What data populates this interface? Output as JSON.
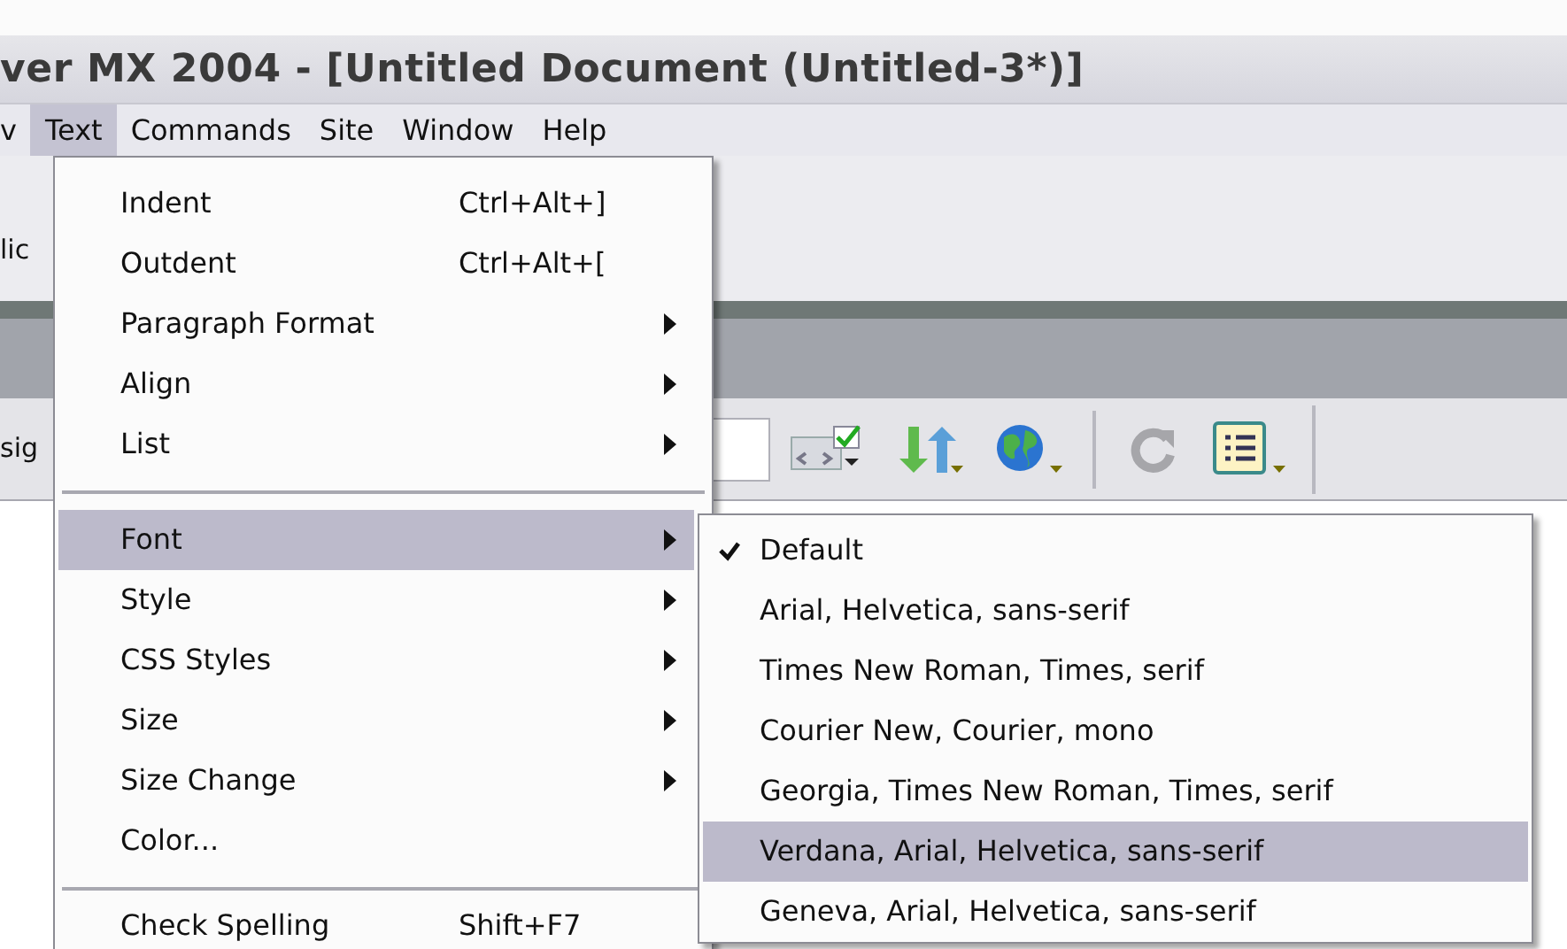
{
  "window": {
    "title": "ver MX 2004 - [Untitled Document (Untitled-3*)]"
  },
  "menu_bar": [
    {
      "label": "v",
      "selected": false
    },
    {
      "label": "Text",
      "selected": true
    },
    {
      "label": "Commands",
      "selected": false
    },
    {
      "label": "Site",
      "selected": false
    },
    {
      "label": "Window",
      "selected": false
    },
    {
      "label": "Help",
      "selected": false
    }
  ],
  "toolbar_1": {
    "label": "lic"
  },
  "toolbar_2": {
    "label": "sig"
  },
  "text_menu": [
    {
      "kind": "item",
      "label": "Indent",
      "shortcut": "Ctrl+Alt+]",
      "selected": false
    },
    {
      "kind": "item",
      "label": "Outdent",
      "shortcut": "Ctrl+Alt+[",
      "selected": false
    },
    {
      "kind": "submenu",
      "label": "Paragraph Format",
      "selected": false
    },
    {
      "kind": "submenu",
      "label": "Align",
      "selected": false
    },
    {
      "kind": "submenu",
      "label": "List",
      "selected": false
    },
    {
      "kind": "separator"
    },
    {
      "kind": "submenu",
      "label": "Font",
      "selected": true
    },
    {
      "kind": "submenu",
      "label": "Style",
      "selected": false
    },
    {
      "kind": "submenu",
      "label": "CSS Styles",
      "selected": false
    },
    {
      "kind": "submenu",
      "label": "Size",
      "selected": false
    },
    {
      "kind": "submenu",
      "label": "Size Change",
      "selected": false
    },
    {
      "kind": "item",
      "label": "Color...",
      "selected": false
    },
    {
      "kind": "separator"
    },
    {
      "kind": "item",
      "label": "Check Spelling",
      "shortcut": "Shift+F7",
      "selected": false
    }
  ],
  "font_submenu": [
    {
      "label": "Default",
      "checked": true,
      "selected": false
    },
    {
      "label": "Arial, Helvetica, sans-serif",
      "checked": false,
      "selected": false
    },
    {
      "label": "Times New Roman, Times, serif",
      "checked": false,
      "selected": false
    },
    {
      "label": "Courier New, Courier, mono",
      "checked": false,
      "selected": false
    },
    {
      "label": "Georgia, Times New Roman, Times, serif",
      "checked": false,
      "selected": false
    },
    {
      "label": "Verdana, Arial, Helvetica, sans-serif",
      "checked": false,
      "selected": true
    },
    {
      "label": "Geneva, Arial, Helvetica, sans-serif",
      "checked": false,
      "selected": false
    }
  ]
}
